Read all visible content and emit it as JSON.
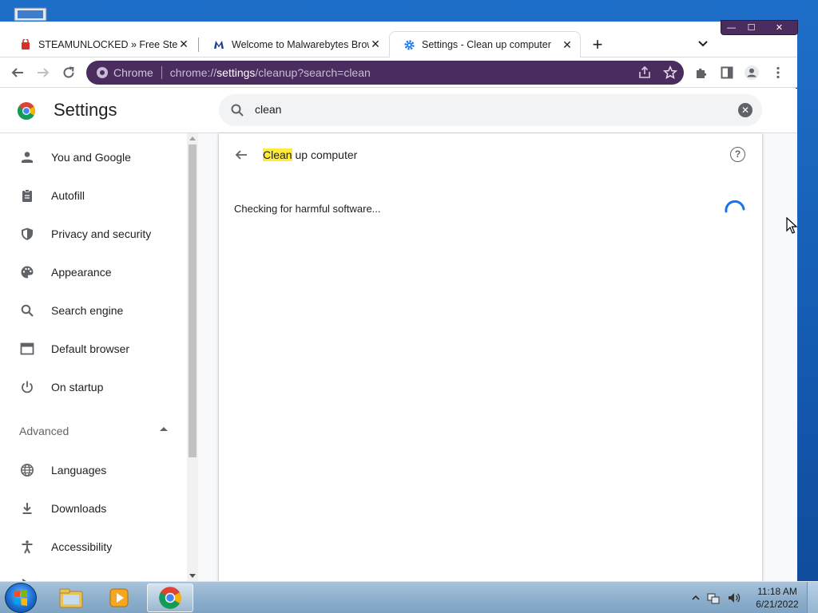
{
  "tabs": [
    {
      "title": "STEAMUNLOCKED » Free Steam",
      "icon": "steamunlocked-favicon-icon",
      "active": false
    },
    {
      "title": "Welcome to Malwarebytes Brows",
      "icon": "malwarebytes-favicon-icon",
      "active": false
    },
    {
      "title": "Settings - Clean up computer",
      "icon": "settings-gear-favicon-icon",
      "active": true
    }
  ],
  "new_tab_label": "+",
  "window_controls": {
    "minimize": "—",
    "maximize": "☐",
    "close": "✕"
  },
  "omnibox": {
    "chrome_label": "Chrome",
    "url_scheme": "chrome://",
    "url_host": "settings",
    "url_path": "/cleanup?search=clean"
  },
  "settings": {
    "title": "Settings",
    "search_value": "clean"
  },
  "sidebar": {
    "items": [
      {
        "label": "You and Google",
        "icon": "person-icon"
      },
      {
        "label": "Autofill",
        "icon": "clipboard-icon"
      },
      {
        "label": "Privacy and security",
        "icon": "shield-icon"
      },
      {
        "label": "Appearance",
        "icon": "palette-icon"
      },
      {
        "label": "Search engine",
        "icon": "search-icon"
      },
      {
        "label": "Default browser",
        "icon": "browser-icon"
      },
      {
        "label": "On startup",
        "icon": "power-icon"
      }
    ],
    "advanced_label": "Advanced",
    "advanced_items": [
      {
        "label": "Languages",
        "icon": "globe-icon"
      },
      {
        "label": "Downloads",
        "icon": "download-icon"
      },
      {
        "label": "Accessibility",
        "icon": "accessibility-icon"
      }
    ]
  },
  "main": {
    "heading_highlight": "Clean",
    "heading_rest": " up computer",
    "status": "Checking for harmful software...",
    "help_glyph": "?"
  },
  "taskbar": {
    "time": "11:18 AM",
    "date": "6/21/2022",
    "apps": [
      "explorer-icon",
      "media-player-icon",
      "chrome-icon"
    ]
  },
  "colors": {
    "omnibox_bg": "#4a2c5e",
    "highlight": "#ffeb3b",
    "spinner": "#1a73e8"
  }
}
